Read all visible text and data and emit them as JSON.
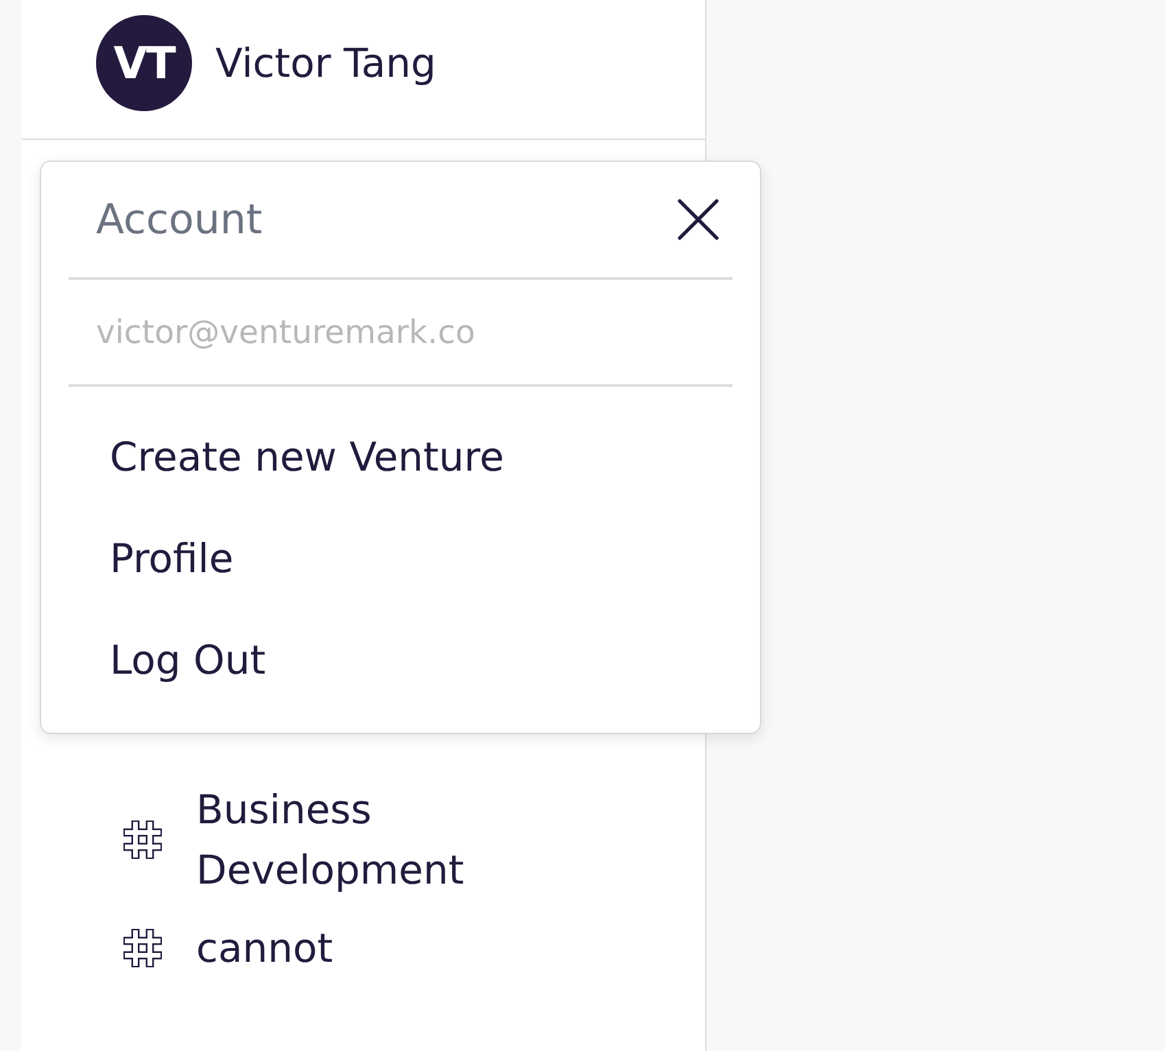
{
  "sidebar": {
    "user": {
      "initials": "VT",
      "name": "Victor Tang"
    },
    "channels": [
      {
        "name": "Business Development"
      },
      {
        "name": "cannot"
      }
    ]
  },
  "account_menu": {
    "title": "Account",
    "email": "victor@venturemark.co",
    "items": [
      {
        "label": "Create new Venture"
      },
      {
        "label": "Profile"
      },
      {
        "label": "Log Out"
      }
    ]
  }
}
